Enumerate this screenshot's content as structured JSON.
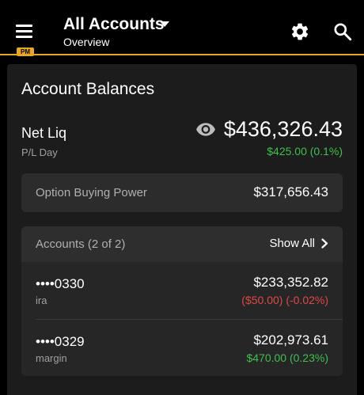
{
  "header": {
    "title": "All Accounts",
    "subtitle": "Overview",
    "badge": "PM",
    "icons": [
      "menu-icon",
      "chevron-down-icon",
      "gear-icon",
      "search-icon"
    ]
  },
  "balances": {
    "title": "Account Balances",
    "net_liq_label": "Net Liq",
    "pl_day_label": "P/L Day",
    "net_liq_value": "$436,326.43",
    "pl_day_value": "$425.00 (0.1%)",
    "visibility_icon": "eye-icon"
  },
  "option_buying_power": {
    "label": "Option Buying Power",
    "value": "$317,656.43"
  },
  "accounts": {
    "header_label": "Accounts (2 of 2)",
    "show_all_label": "Show All",
    "items": [
      {
        "number": "••••0330",
        "type": "ira",
        "balance": "$233,352.82",
        "pl": "($50.00) (-0.02%)",
        "pl_status": "negative"
      },
      {
        "number": "••••0329",
        "type": "margin",
        "balance": "$202,973.61",
        "pl": "$470.00 (0.23%)",
        "pl_status": "positive"
      }
    ]
  },
  "colors": {
    "accent": "#e8a623",
    "positive": "#3fbf4f",
    "negative": "#e04848",
    "background": "#000000",
    "card": "#1c1c1c"
  }
}
